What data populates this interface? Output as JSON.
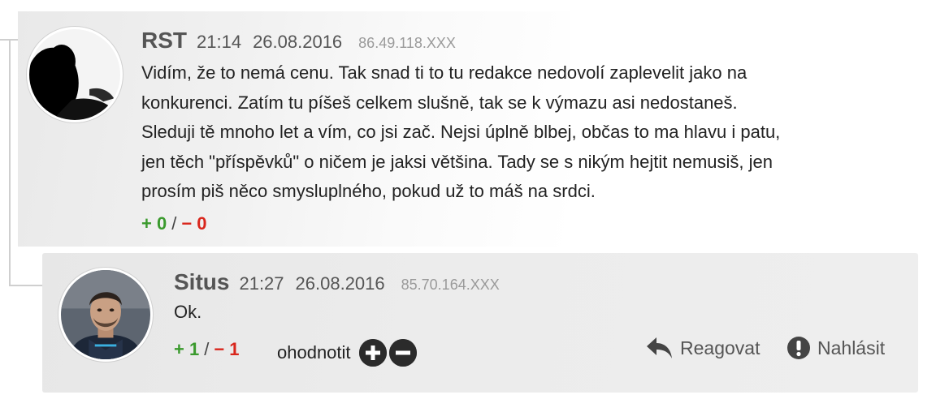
{
  "parent_comment": {
    "author": "RST",
    "time": "21:14",
    "date": "26.08.2016",
    "ip": "86.49.118.XXX",
    "text_lines": [
      "Vidím, že to nemá cenu. Tak snad ti to tu redakce nedovolí zaplevelit jako na",
      "konkurenci. Zatím tu píšeš celkem slušně, tak se k výmazu asi nedostaneš.",
      "Sleduji tě mnoho let a vím, co jsi zač. Nejsi úplně blbej, občas to ma hlavu i patu,",
      "jen těch \"příspěvků\" o ničem je jaksi většina. Tady se s nikým hejtit nemusiš, jen",
      "prosím piš něco smysluplného, pokud už to máš na srdci."
    ],
    "votes": {
      "plus": "+ 0",
      "separator": "/",
      "minus": "− 0"
    },
    "avatar_icon": "user-photo-silhouette"
  },
  "reply_comment": {
    "author": "Situs",
    "time": "21:27",
    "date": "26.08.2016",
    "ip": "85.70.164.XXX",
    "text": "Ok.",
    "votes": {
      "plus": "+ 1",
      "separator": "/",
      "minus": "− 1"
    },
    "rate_label": "ohodnotit",
    "reply_label": "Reagovat",
    "report_label": "Nahlásit",
    "avatar_icon": "user-photo-portrait"
  },
  "colors": {
    "vote_plus": "#3a9a2d",
    "vote_minus": "#d9261c",
    "meta_text": "#555555",
    "ip_text": "#9a9a9a",
    "reply_background": "#ebebeb"
  },
  "icons": {
    "rate_up": "plus-circle-icon",
    "rate_down": "minus-circle-icon",
    "reply": "reply-arrow-icon",
    "report": "exclamation-circle-icon"
  }
}
